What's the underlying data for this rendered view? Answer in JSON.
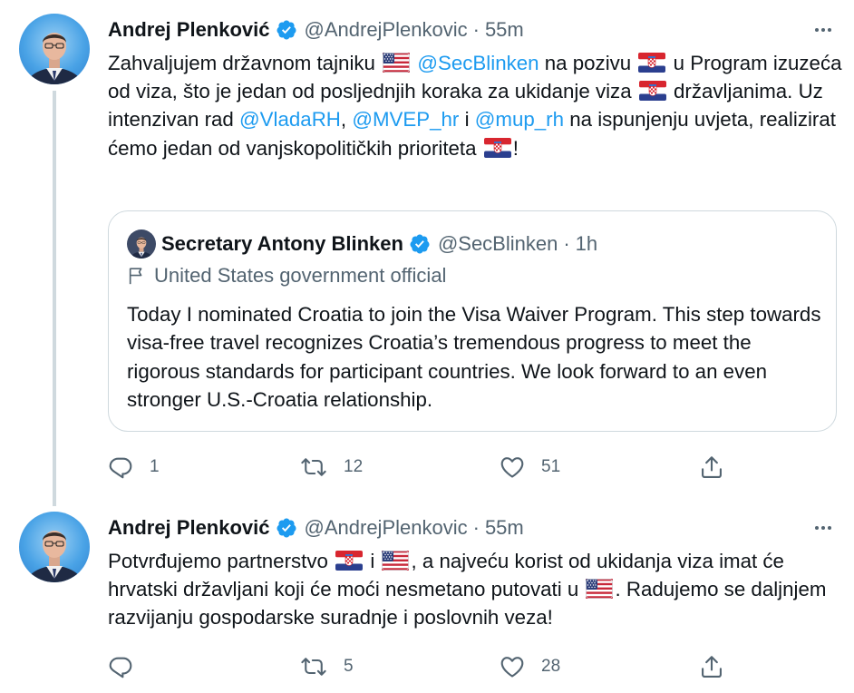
{
  "tweets": [
    {
      "author": "Andrej Plenković",
      "handle": "@AndrejPlenkovic",
      "separator": "·",
      "time": "55m",
      "text": {
        "p1": "Zahvaljujem državnom tajniku",
        "m1": "@SecBlinken",
        "p2": "na pozivu",
        "p3": "u Program izuzeća od viza, što je jedan od posljednjih koraka za ukidanje viza",
        "p4": "državljanima. Uz intenzivan rad",
        "m2": "@VladaRH",
        "p5": ",",
        "m3": "@MVEP_hr",
        "p6": "i",
        "m4": "@mup_rh",
        "p7": "na ispunjenju uvjeta, realizirat ćemo jedan od vanjskopolitičkih prioriteta",
        "p8": "!"
      },
      "quote": {
        "author": "Secretary Antony Blinken",
        "handle": "@SecBlinken",
        "separator": "·",
        "time": "1h",
        "label": "United States government official",
        "text": "Today I nominated Croatia to join the Visa Waiver Program. This step towards visa-free travel recognizes Croatia’s tremendous progress to meet the rigorous standards for participant countries. We look forward to an even stronger U.S.-Croatia relationship."
      },
      "replies": "1",
      "retweets": "12",
      "likes": "51"
    },
    {
      "author": "Andrej Plenković",
      "handle": "@AndrejPlenkovic",
      "separator": "·",
      "time": "55m",
      "text": {
        "p1": "Potvrđujemo partnerstvo",
        "p2": "i",
        "p3": ", a najveću korist od ukidanja viza imat će hrvatski državljani koji će moći nesmetano putovati u",
        "p4": ". Radujemo se daljnjem razvijanju gospodarske suradnje i poslovnih veza!"
      },
      "replies": "",
      "retweets": "5",
      "likes": "28"
    }
  ],
  "icons": {
    "verified": "verified-badge-icon",
    "more": "more-icon",
    "reply": "reply-icon",
    "retweet": "retweet-icon",
    "like": "like-icon",
    "share": "share-icon",
    "gov_label": "flag-icon",
    "flag_us": "us-flag-icon",
    "flag_hr": "croatia-flag-icon"
  },
  "colors": {
    "accent": "#1d9bf0",
    "text": "#0f1419",
    "secondary": "#536471",
    "border": "#cfd9de"
  }
}
